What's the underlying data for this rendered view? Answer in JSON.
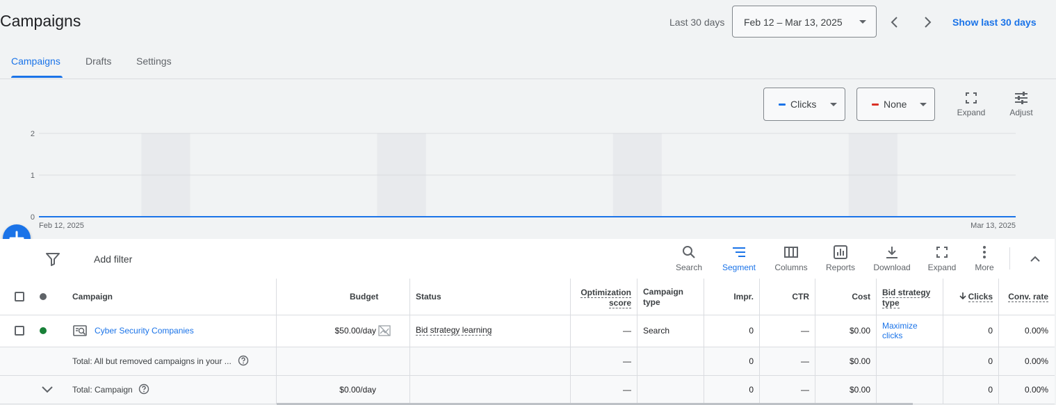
{
  "header": {
    "title": "Campaigns",
    "date_label": "Last 30 days",
    "date_range": "Feb 12 – Mar 13, 2025",
    "show_last": "Show last 30 days"
  },
  "tabs": [
    {
      "label": "Campaigns",
      "active": true
    },
    {
      "label": "Drafts",
      "active": false
    },
    {
      "label": "Settings",
      "active": false
    }
  ],
  "chart_controls": {
    "metric1": {
      "label": "Clicks",
      "color": "#1a73e8"
    },
    "metric2": {
      "label": "None",
      "color": "#d93025"
    },
    "expand": "Expand",
    "adjust": "Adjust"
  },
  "chart_data": {
    "type": "line",
    "x_start_label": "Feb 12, 2025",
    "x_end_label": "Mar 13, 2025",
    "yticks": [
      "2",
      "1",
      "0"
    ],
    "ylim": [
      0,
      2
    ],
    "series": [
      {
        "values": [
          0,
          0,
          0,
          0,
          0,
          0,
          0,
          0,
          0,
          0,
          0,
          0,
          0,
          0,
          0,
          0,
          0,
          0,
          0,
          0,
          0,
          0,
          0,
          0,
          0,
          0,
          0,
          0,
          0,
          0
        ],
        "color": "#1a73e8"
      }
    ],
    "grid": true
  },
  "toolbar": {
    "add_filter": "Add filter",
    "search": "Search",
    "segment": "Segment",
    "columns": "Columns",
    "reports": "Reports",
    "download": "Download",
    "expand": "Expand",
    "more": "More"
  },
  "table": {
    "headers": {
      "campaign": "Campaign",
      "budget": "Budget",
      "status": "Status",
      "opt_score_1": "Optimization",
      "opt_score_2": "score",
      "campaign_type_1": "Campaign",
      "campaign_type_2": "type",
      "impr": "Impr.",
      "ctr": "CTR",
      "cost": "Cost",
      "bid_strategy_1": "Bid strategy",
      "bid_strategy_2": "type",
      "clicks": "Clicks",
      "conv_rate": "Conv. rate"
    },
    "row": {
      "status_color": "#188038",
      "campaign": "Cyber Security Companies",
      "budget": "$50.00/day",
      "status": "Bid strategy learning",
      "opt_score": "—",
      "campaign_type": "Search",
      "impr": "0",
      "ctr": "—",
      "cost": "$0.00",
      "bid_strategy_1": "Maximize",
      "bid_strategy_2": "clicks",
      "clicks": "0",
      "conv_rate": "0.00%"
    },
    "total_all": {
      "label": "Total: All but removed campaigns in your ...",
      "opt_score": "—",
      "impr": "0",
      "ctr": "—",
      "cost": "$0.00",
      "clicks": "0",
      "conv_rate": "0.00%"
    },
    "total_campaign": {
      "label": "Total: Campaign",
      "budget": "$0.00/day",
      "opt_score": "—",
      "impr": "0",
      "ctr": "—",
      "cost": "$0.00",
      "clicks": "0",
      "conv_rate": "0.00%"
    }
  }
}
